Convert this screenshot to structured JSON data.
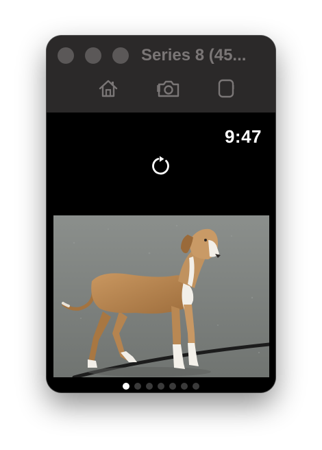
{
  "window": {
    "title": "Series 8 (45..."
  },
  "toolbar": {
    "buttons": [
      {
        "icon": "home-icon",
        "action": "home"
      },
      {
        "icon": "camera-icon",
        "action": "screenshot"
      },
      {
        "icon": "rotate-device-icon",
        "action": "rotate"
      }
    ]
  },
  "watch": {
    "time": "9:47",
    "reload_icon": "arrow-clockwise-icon",
    "image_subject": "tan and white dog standing on asphalt",
    "pages": {
      "count": 7,
      "current": 1
    }
  },
  "colors": {
    "titlebar": "#2b2929",
    "screen": "#000000",
    "icon": "#7a7676",
    "text": "#ffffff"
  }
}
